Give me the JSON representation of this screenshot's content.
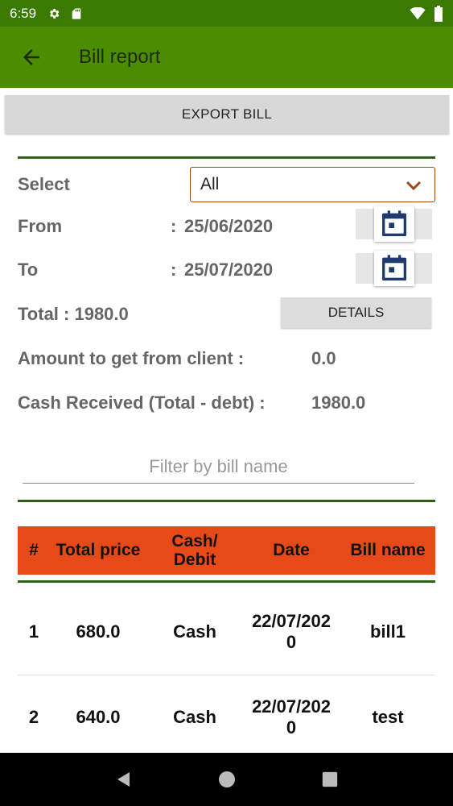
{
  "status": {
    "time": "6:59",
    "icons": [
      "gear-icon",
      "sd-card-icon",
      "wifi-icon",
      "battery-icon"
    ]
  },
  "appbar": {
    "title": "Bill report",
    "back_icon": "arrow-left-icon",
    "color": "#4c8c00"
  },
  "export_label": "EXPORT BILL",
  "form": {
    "select_label": "Select",
    "select_value": "All",
    "from_label": "From",
    "from_colon": ":",
    "from_value": "25/06/2020",
    "to_label": "To",
    "to_colon": ":",
    "to_value": "25/07/2020",
    "total_text": "Total : 1980.0",
    "details_label": "DETAILS",
    "amount_label": "Amount to get from client :",
    "amount_value": "0.0",
    "cash_label": "Cash Received (Total - debt) :",
    "cash_value": "1980.0"
  },
  "filter": {
    "placeholder": "Filter by bill name"
  },
  "table": {
    "header_color": "#e64a19",
    "columns": [
      "#",
      "Total price",
      "Cash/\nDebit",
      "Date",
      "Bill name"
    ],
    "rows": [
      {
        "num": "1",
        "total": "680.0",
        "type": "Cash",
        "date": "22/07/202\n0",
        "name": "bill1"
      },
      {
        "num": "2",
        "total": "640.0",
        "type": "Cash",
        "date": "22/07/202\n0",
        "name": "test"
      }
    ]
  },
  "navbar": {
    "icons": [
      "back-triangle-icon",
      "home-circle-icon",
      "recents-square-icon"
    ]
  }
}
